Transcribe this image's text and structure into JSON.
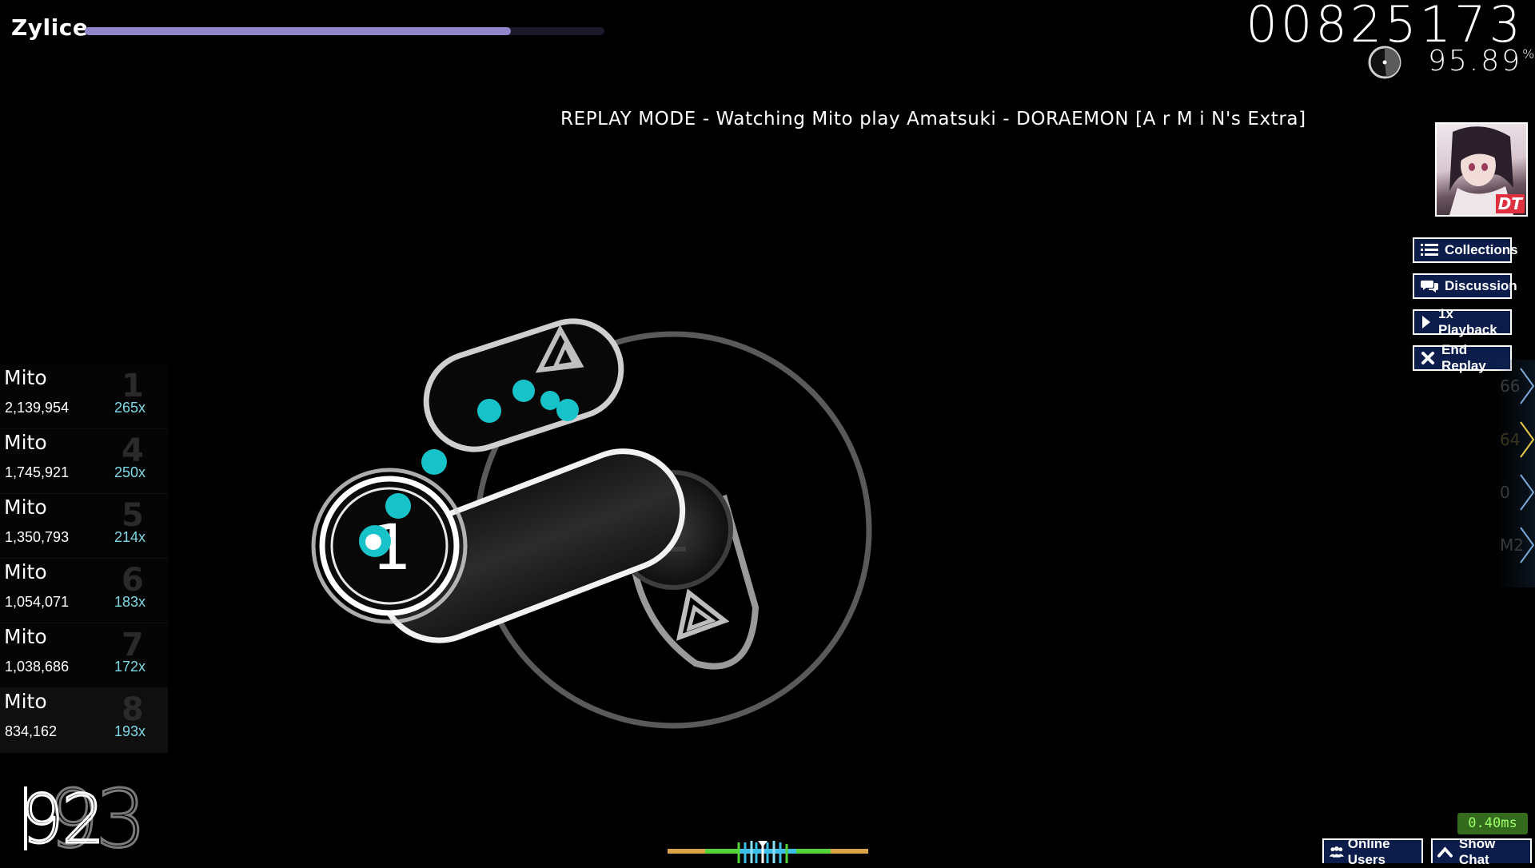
{
  "player": {
    "name": "Zylice",
    "health": 0.82
  },
  "score": {
    "value": "00825173",
    "accuracy": "95.89",
    "accuracy_unit": "%"
  },
  "replay_banner": "REPLAY MODE - Watching Mito play Amatsuki - DORAEMON [A r M i N's Extra]",
  "avatar": {
    "mod": "DT"
  },
  "side_buttons": [
    {
      "label": "Collections",
      "icon": "list-icon"
    },
    {
      "label": "Discussion",
      "icon": "chat-icon"
    },
    {
      "label": "1x Playback",
      "icon": "play-icon"
    },
    {
      "label": "End Replay",
      "icon": "close-icon"
    }
  ],
  "right_panel": [
    {
      "value": "66",
      "color": "#7aa8d8"
    },
    {
      "value": "64",
      "color": "#e6c84a"
    },
    {
      "value": "0",
      "color": "#7aa8d8"
    },
    {
      "value": "M2",
      "color": "#7aa8d8"
    }
  ],
  "leaderboard": [
    {
      "name": "Mito",
      "score": "2,139,954",
      "combo": "265x",
      "rank": "1"
    },
    {
      "name": "Mito",
      "score": "1,745,921",
      "combo": "250x",
      "rank": "4"
    },
    {
      "name": "Mito",
      "score": "1,350,793",
      "combo": "214x",
      "rank": "5"
    },
    {
      "name": "Mito",
      "score": "1,054,071",
      "combo": "183x",
      "rank": "6"
    },
    {
      "name": "Mito",
      "score": "1,038,686",
      "combo": "172x",
      "rank": "7"
    },
    {
      "name": "Mito",
      "score": "834,162",
      "combo": "193x",
      "rank": "8"
    }
  ],
  "combo": {
    "current": "92",
    "ghost": "93"
  },
  "hit_objects": {
    "circle_1": "1",
    "circle_2": "2"
  },
  "latency": "0.40ms",
  "bottom_buttons": {
    "online_users": "Online Users",
    "show_chat": "Show Chat"
  },
  "colors": {
    "accent": "#8f87c9",
    "cursor_trail": "#17c3c8",
    "button_bg": "#0c1d4c"
  }
}
